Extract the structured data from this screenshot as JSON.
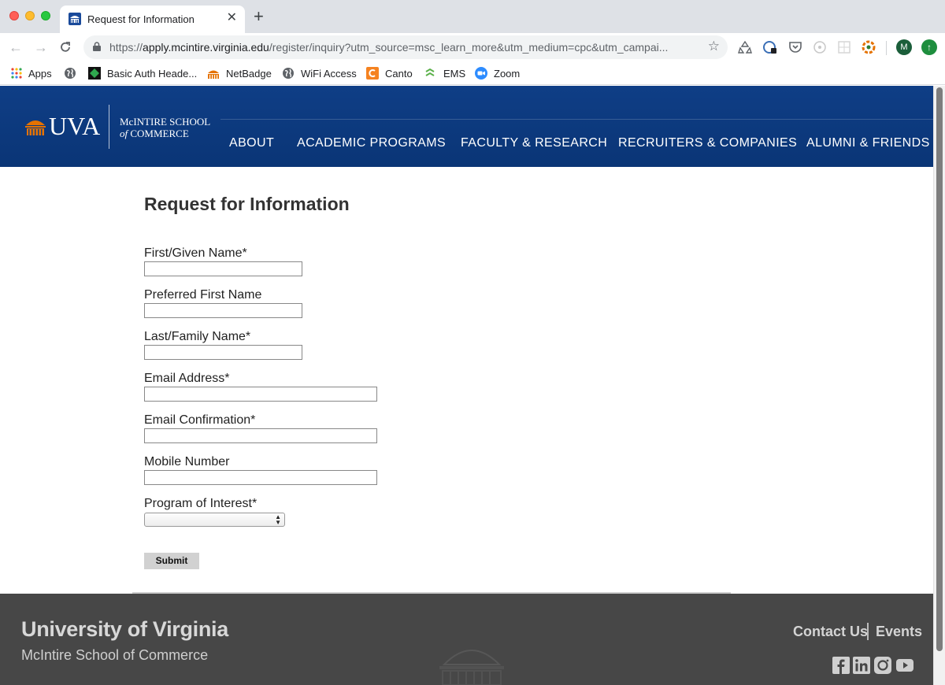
{
  "browser": {
    "tab_title": "Request for Information",
    "tab_close": "✕",
    "new_tab": "+",
    "url_scheme": "https://",
    "url_host": "apply.mcintire.virginia.edu",
    "url_path": "/register/inquiry?utm_source=msc_learn_more&utm_medium=cpc&utm_campai...",
    "avatar_initial": "M",
    "bookmarks": [
      {
        "label": "Apps"
      },
      {
        "label": ""
      },
      {
        "label": "Basic Auth Heade..."
      },
      {
        "label": "NetBadge"
      },
      {
        "label": "WiFi Access"
      },
      {
        "label": "Canto"
      },
      {
        "label": "EMS"
      },
      {
        "label": "Zoom"
      }
    ]
  },
  "header": {
    "logo_text": "UVA",
    "school_line1": "McINTIRE SCHOOL",
    "school_line2_prefix": "of",
    "school_line2_rest": " COMMERCE",
    "nav": [
      "ABOUT",
      "ACADEMIC PROGRAMS",
      "FACULTY & RESEARCH",
      "RECRUITERS & COMPANIES",
      "ALUMNI & FRIENDS"
    ]
  },
  "form": {
    "title": "Request for Information",
    "fields": [
      {
        "label": "First/Given Name*",
        "value": ""
      },
      {
        "label": "Preferred First Name",
        "value": ""
      },
      {
        "label": "Last/Family Name*",
        "value": ""
      },
      {
        "label": "Email Address*",
        "value": ""
      },
      {
        "label": "Email Confirmation*",
        "value": ""
      },
      {
        "label": "Mobile Number",
        "value": ""
      }
    ],
    "program_label": "Program of Interest*",
    "program_value": "",
    "submit_label": "Submit"
  },
  "footer": {
    "university": "University of Virginia",
    "school": "McIntire School of Commerce",
    "links": [
      "Contact Us",
      "Events"
    ],
    "social": [
      "facebook-icon",
      "linkedin-icon",
      "instagram-icon",
      "youtube-icon"
    ]
  },
  "colors": {
    "header_blue": "#0f3e86",
    "footer_gray": "#474747",
    "uva_orange": "#e57200"
  }
}
